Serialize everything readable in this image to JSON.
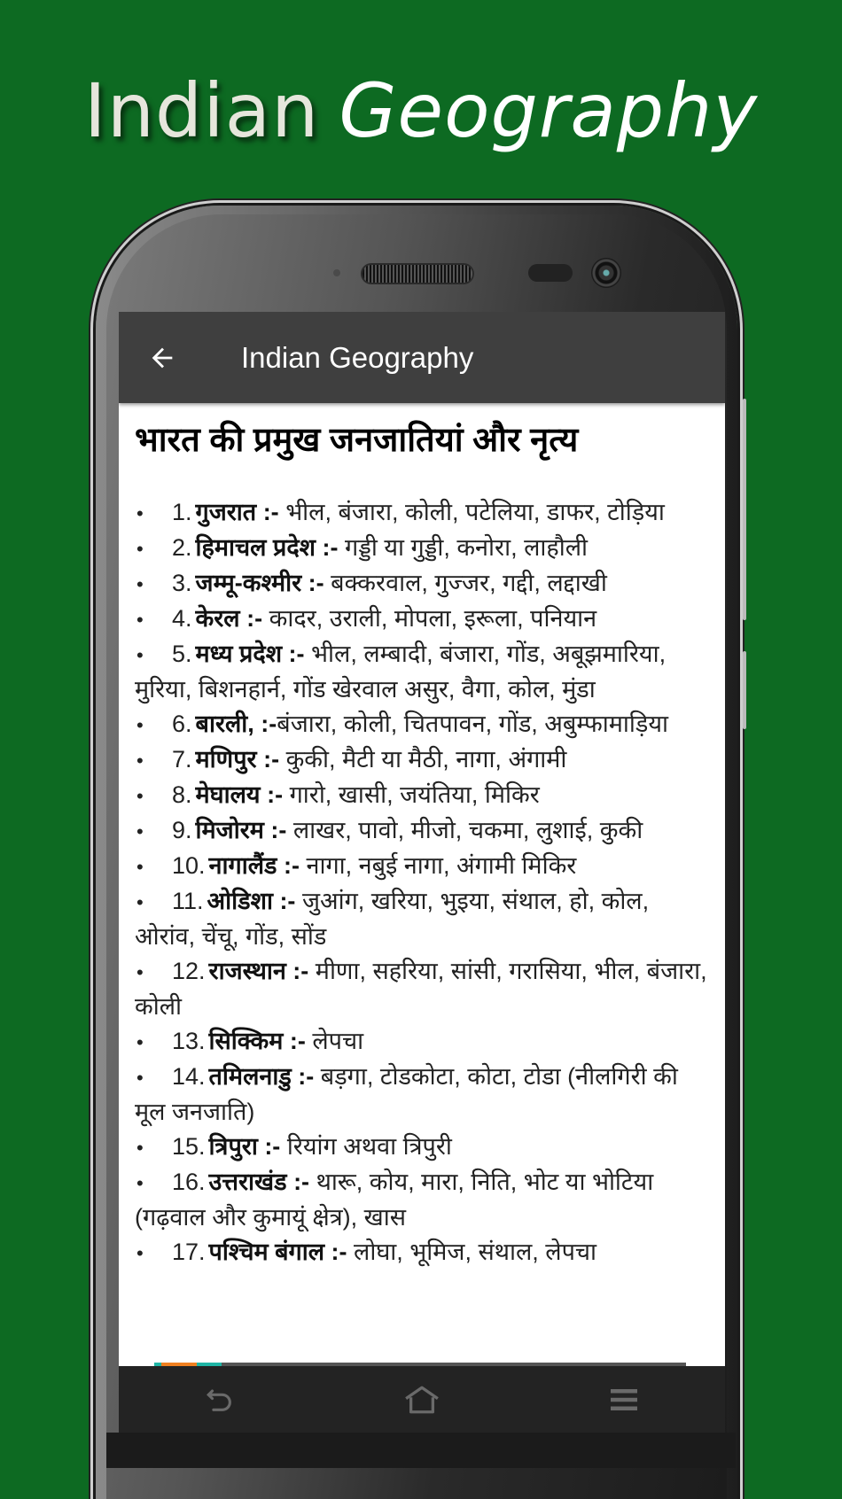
{
  "banner": {
    "title_word1": "Indian",
    "title_word2": "Geography"
  },
  "app": {
    "title": "Indian Geography",
    "back_icon": "arrow-left-icon"
  },
  "content": {
    "heading": "भारत की प्रमुख जनजातियां और नृत्य",
    "items": [
      {
        "num": "1.",
        "state": "गुजरात :-",
        "tribes": " भील, बंजारा, कोली, पटेलिया, डाफर, टोड़िया"
      },
      {
        "num": "2.",
        "state": "हिमाचल प्रदेश :-",
        "tribes": " गड्डी या गुड्डी, कनोरा, लाहौली"
      },
      {
        "num": "3.",
        "state": "जम्मू-कश्मीर :-",
        "tribes": " बक्करवाल, गुज्जर, गद्दी, लद्दाखी"
      },
      {
        "num": "4.",
        "state": "केरल :-",
        "tribes": " कादर, उराली, मोपला, इरूला, पनियान"
      },
      {
        "num": "5.",
        "state": "मध्य प्रदेश :-",
        "tribes": " भील, लम्बादी, बंजारा, गोंड, अबूझमारिया, मुरिया, बिशनहार्न, गोंड खेरवाल असुर, वैगा, कोल, मुंडा"
      },
      {
        "num": "6.",
        "state": "बारली, :-",
        "tribes": "बंजारा, कोली, चितपावन, गोंड, अबुम्फामाड़िया"
      },
      {
        "num": "7.",
        "state": "मणिपुर :-",
        "tribes": " कुकी, मैटी या मैठी, नागा, अंगामी"
      },
      {
        "num": "8.",
        "state": "मेघालय :-",
        "tribes": " गारो, खासी, जयंतिया, मिकिर"
      },
      {
        "num": "9.",
        "state": "मिजोरम :-",
        "tribes": " लाखर, पावो, मीजो, चकमा, लुशाई, कुकी"
      },
      {
        "num": "10.",
        "state": "नागालैंड :-",
        "tribes": " नागा, नबुई नागा, अंगामी मिकिर"
      },
      {
        "num": "11.",
        "state": "ओडिशा :-",
        "tribes": " जुआंग, खरिया, भुइया, संथाल, हो, कोल, ओरांव, चेंचू, गोंड, सोंड"
      },
      {
        "num": "12.",
        "state": "राजस्थान :-",
        "tribes": " मीणा, सहरिया, सांसी, गरासिया, भील, बंजारा, कोली"
      },
      {
        "num": "13.",
        "state": "सिक्किम :-",
        "tribes": " लेपचा"
      },
      {
        "num": "14.",
        "state": "तमिलनाडु :-",
        "tribes": " बड़गा, टोडकोटा, कोटा, टोडा (नीलगिरी की मूल जनजाति)"
      },
      {
        "num": "15.",
        "state": "त्रिपुरा :-",
        "tribes": " रियांग अथवा त्रिपुरी"
      },
      {
        "num": "16.",
        "state": "उत्तराखंड :-",
        "tribes": " थारू, कोय, मारा, निति, भोट या भोटिया (गढ़वाल और कुमायूं क्षेत्र), खास"
      },
      {
        "num": "17.",
        "state": "पश्चिम बंगाल :-",
        "tribes": " लोघा, भूमिज, संथाल, लेपचा"
      }
    ]
  },
  "navbar": {
    "back": "back-icon",
    "home": "home-icon",
    "menu": "menu-icon"
  },
  "colors": {
    "background": "#0d6a22",
    "appbar": "#3f3f3f",
    "accent_orange": "#f08020",
    "accent_teal": "#1fb5a5"
  }
}
